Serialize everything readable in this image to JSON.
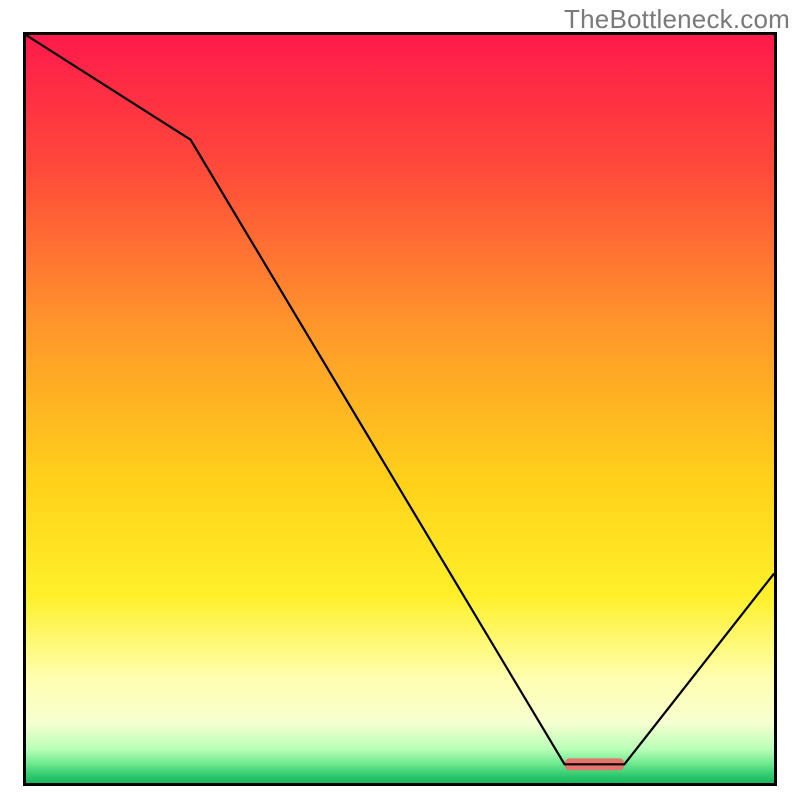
{
  "watermark": "TheBottleneck.com",
  "chart_data": {
    "type": "line",
    "title": "",
    "xlabel": "",
    "ylabel": "",
    "xlim": [
      0,
      100
    ],
    "ylim": [
      0,
      100
    ],
    "grid": false,
    "legend": false,
    "gradient_stops": [
      {
        "offset": 0,
        "color": "#ff1a4b"
      },
      {
        "offset": 0.18,
        "color": "#ff4a3a"
      },
      {
        "offset": 0.4,
        "color": "#ff9a2a"
      },
      {
        "offset": 0.6,
        "color": "#ffd21a"
      },
      {
        "offset": 0.75,
        "color": "#fff02a"
      },
      {
        "offset": 0.86,
        "color": "#ffffb0"
      },
      {
        "offset": 0.92,
        "color": "#f6ffd0"
      },
      {
        "offset": 0.955,
        "color": "#b8ffb8"
      },
      {
        "offset": 0.974,
        "color": "#6fe88f"
      },
      {
        "offset": 0.99,
        "color": "#2fc96f"
      },
      {
        "offset": 1.0,
        "color": "#18b85e"
      }
    ],
    "series": [
      {
        "name": "bottleneck-curve",
        "x": [
          0,
          22,
          72,
          80,
          100
        ],
        "values": [
          100,
          86,
          2.5,
          2.5,
          28
        ]
      }
    ],
    "marker": {
      "name": "highlight-bar",
      "x_start": 72,
      "x_end": 80,
      "y": 2.5,
      "color": "#e4746d"
    }
  }
}
